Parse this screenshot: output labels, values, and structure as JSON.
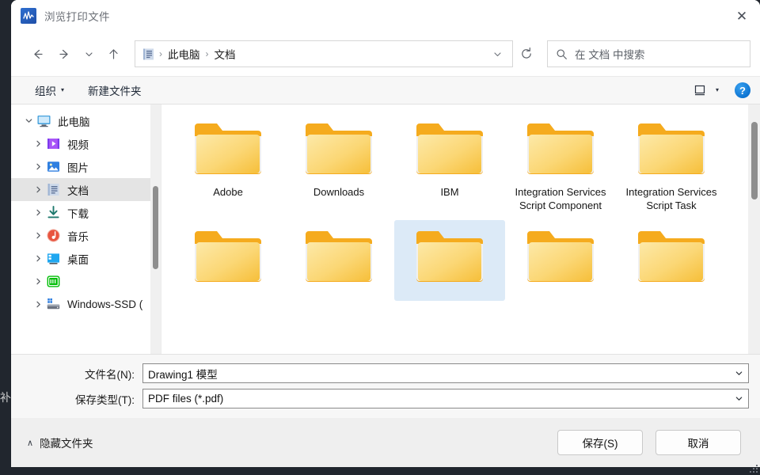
{
  "window": {
    "title": "浏览打印文件",
    "app_icon": "waveform-icon",
    "close_label": "✕"
  },
  "nav": {
    "back": "back-arrow",
    "forward": "forward-arrow",
    "recent": "chevron-down",
    "up": "up-arrow",
    "refresh": "refresh-icon",
    "address_dropdown": "chevron-down",
    "breadcrumb_icon": "documents-folder-icon",
    "breadcrumbs": [
      "此电脑",
      "文档"
    ],
    "separator": "›"
  },
  "search": {
    "placeholder": "在 文档 中搜索",
    "icon": "search-icon"
  },
  "toolbar": {
    "organize_label": "组织",
    "organize_caret": "▾",
    "new_folder_label": "新建文件夹",
    "view_icon": "view-layout-icon",
    "view_caret": "▾",
    "help_label": "?"
  },
  "sidebar": {
    "items": [
      {
        "label": "此电脑",
        "icon": "monitor-icon",
        "level": 1,
        "expander": "expanded",
        "selected": false
      },
      {
        "label": "视频",
        "icon": "videos-icon",
        "level": 2,
        "expander": "collapsed",
        "selected": false
      },
      {
        "label": "图片",
        "icon": "pictures-icon",
        "level": 2,
        "expander": "collapsed",
        "selected": false
      },
      {
        "label": "文档",
        "icon": "documents-icon",
        "level": 2,
        "expander": "collapsed",
        "selected": true
      },
      {
        "label": "下载",
        "icon": "downloads-icon",
        "level": 2,
        "expander": "collapsed",
        "selected": false
      },
      {
        "label": "音乐",
        "icon": "music-icon",
        "level": 2,
        "expander": "collapsed",
        "selected": false
      },
      {
        "label": "桌面",
        "icon": "desktop-icon",
        "level": 2,
        "expander": "collapsed",
        "selected": false
      },
      {
        "label": "",
        "icon": "iqiyi-icon",
        "level": 2,
        "expander": "collapsed",
        "selected": false
      },
      {
        "label": "Windows-SSD (",
        "icon": "disk-drive-icon",
        "level": 2,
        "expander": "collapsed",
        "selected": false
      }
    ]
  },
  "files": {
    "items": [
      {
        "name": "Adobe",
        "icon": "folder-icon",
        "selected": false
      },
      {
        "name": "Downloads",
        "icon": "folder-icon",
        "selected": false
      },
      {
        "name": "IBM",
        "icon": "folder-icon",
        "selected": false
      },
      {
        "name": "Integration Services Script Component",
        "icon": "folder-icon",
        "selected": false
      },
      {
        "name": "Integration Services Script Task",
        "icon": "folder-icon",
        "selected": false
      },
      {
        "name": "",
        "icon": "folder-icon",
        "selected": false
      },
      {
        "name": "",
        "icon": "folder-icon",
        "selected": false
      },
      {
        "name": "",
        "icon": "folder-icon",
        "selected": true
      },
      {
        "name": "",
        "icon": "folder-icon",
        "selected": false
      },
      {
        "name": "",
        "icon": "folder-icon",
        "selected": false
      }
    ]
  },
  "form": {
    "filename_label": "文件名(N):",
    "filename_value": "Drawing1 模型",
    "filetype_label": "保存类型(T):",
    "filetype_value": "PDF files (*.pdf)",
    "caret": "▾"
  },
  "footer": {
    "hide_folders_caret": "∧",
    "hide_folders_label": "隐藏文件夹",
    "save_label": "保存(S)",
    "cancel_label": "取消"
  },
  "background": {
    "ghost_char": "补"
  },
  "colors": {
    "selection_blue": "#dceaf7",
    "sidebar_selection": "#e4e4e4",
    "folder_yellow": "#f9c335",
    "help_blue": "#0b72d0",
    "desktop_dark": "#21262e",
    "toolbar_gray": "#f7f7f7",
    "footer_gray": "#efefef"
  }
}
